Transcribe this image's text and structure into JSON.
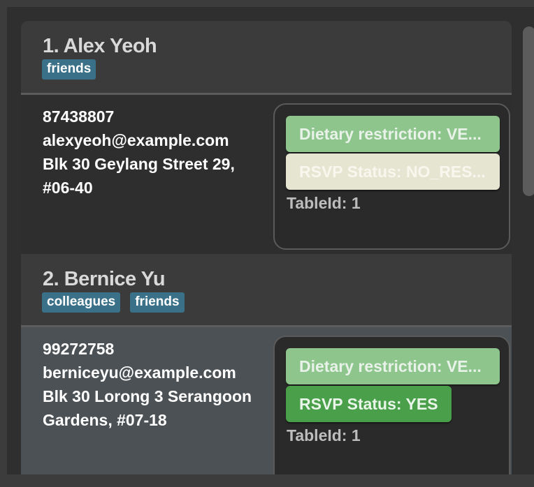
{
  "persons": [
    {
      "name": "1. Alex Yeoh",
      "tags": [
        "friends"
      ],
      "phone": "87438807",
      "email": "alexyeoh@example.com",
      "address_line1": "Blk 30 Geylang Street 29,",
      "address_line2": "#06-40",
      "dietary": "Dietary restriction: VE...",
      "rsvp": "RSVP Status: NO_RES...",
      "table": "TableId: 1"
    },
    {
      "name": "2. Bernice Yu",
      "tags": [
        "colleagues",
        "friends"
      ],
      "phone": "99272758",
      "email": "berniceyu@example.com",
      "address_line1": "Blk 30 Lorong 3 Serangoon",
      "address_line2": "Gardens, #07-18",
      "dietary": "Dietary restriction: VE...",
      "rsvp": "RSVP Status: YES",
      "table": "TableId: 1"
    }
  ],
  "colors": {
    "tag": "#3a7188",
    "dietary_pill": "#8dc58d",
    "rsvp_no_response": "#e6e5d2",
    "rsvp_yes": "#4a9f4a",
    "selected_row": "#4b5155"
  }
}
